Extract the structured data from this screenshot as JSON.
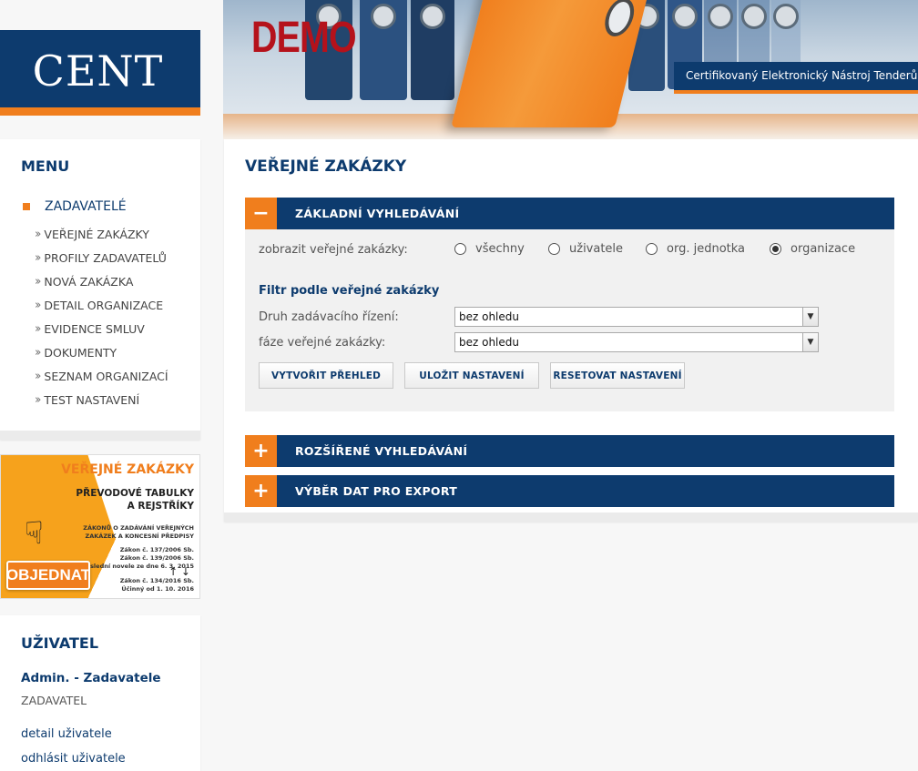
{
  "header": {
    "logo": "CENT",
    "demo_label": "DEMO",
    "tagline": "Certifikovaný Elektronický  Nástroj Tenderů"
  },
  "menu": {
    "title": "MENU",
    "active": "ZADAVATELÉ",
    "items": [
      "VEŘEJNÉ ZAKÁZKY",
      "PROFILY ZADAVATELŮ",
      "NOVÁ ZAKÁZKA",
      "DETAIL ORGANIZACE",
      "EVIDENCE SMLUV",
      "DOKUMENTY",
      "SEZNAM ORGANIZACÍ",
      "TEST NASTAVENÍ"
    ]
  },
  "banner": {
    "title": "VEŘEJNÉ ZAKÁZKY",
    "subtitle_line1": "PŘEVODOVÉ TABULKY",
    "subtitle_line2": "A REJSTŘÍKY",
    "small_line1": "ZÁKONŮ O ZADÁVÁNÍ VEŘEJNÝCH",
    "small_line2": "ZAKÁZEK A KONCESNÍ PŘEDPISY",
    "law1": "Zákon č. 137/2006 Sb.",
    "law2": "Zákon č. 139/2006 Sb.",
    "law_note": "Po poslední novele ze dne 6. 3. 2015",
    "arrows": "↑ ↓",
    "law3": "Zákon č. 134/2016 Sb.",
    "law3_note": "Účinný od 1. 10. 2016",
    "button": "OBJEDNAT"
  },
  "user": {
    "title": "UŽIVATEL",
    "name": "Admin. - Zadavatele",
    "role": "ZADAVATEL",
    "detail_link": "detail uživatele",
    "logout_link": "odhlásit uživatele"
  },
  "main": {
    "title": "VEŘEJNÉ ZAKÁZKY",
    "sections": [
      {
        "toggle": "−",
        "title": "ZÁKLADNÍ VYHLEDÁVÁNÍ"
      },
      {
        "toggle": "+",
        "title": "ROZŠÍŘENÉ VYHLEDÁVÁNÍ"
      },
      {
        "toggle": "+",
        "title": "VÝBĚR DAT PRO EXPORT"
      }
    ],
    "show_label": "zobrazit veřejné zakázky:",
    "radio_options": [
      "všechny",
      "uživatele",
      "org. jednotka",
      "organizace"
    ],
    "radio_selected": "organizace",
    "filter_heading": "Filtr podle veřejné zakázky",
    "druh_label": "Druh zadávacího řízení:",
    "druh_value": "bez ohledu",
    "faze_label": "fáze veřejné zakázky:",
    "faze_value": "bez ohledu",
    "buttons": {
      "create": "VYTVOŘIT PŘEHLED",
      "save": "ULOŽIT NASTAVENÍ",
      "reset": "RESETOVAT NASTAVENÍ"
    }
  },
  "colors": {
    "navy": "#0d3b6e",
    "orange": "#f07e1d",
    "demo_red": "#b5121b"
  }
}
